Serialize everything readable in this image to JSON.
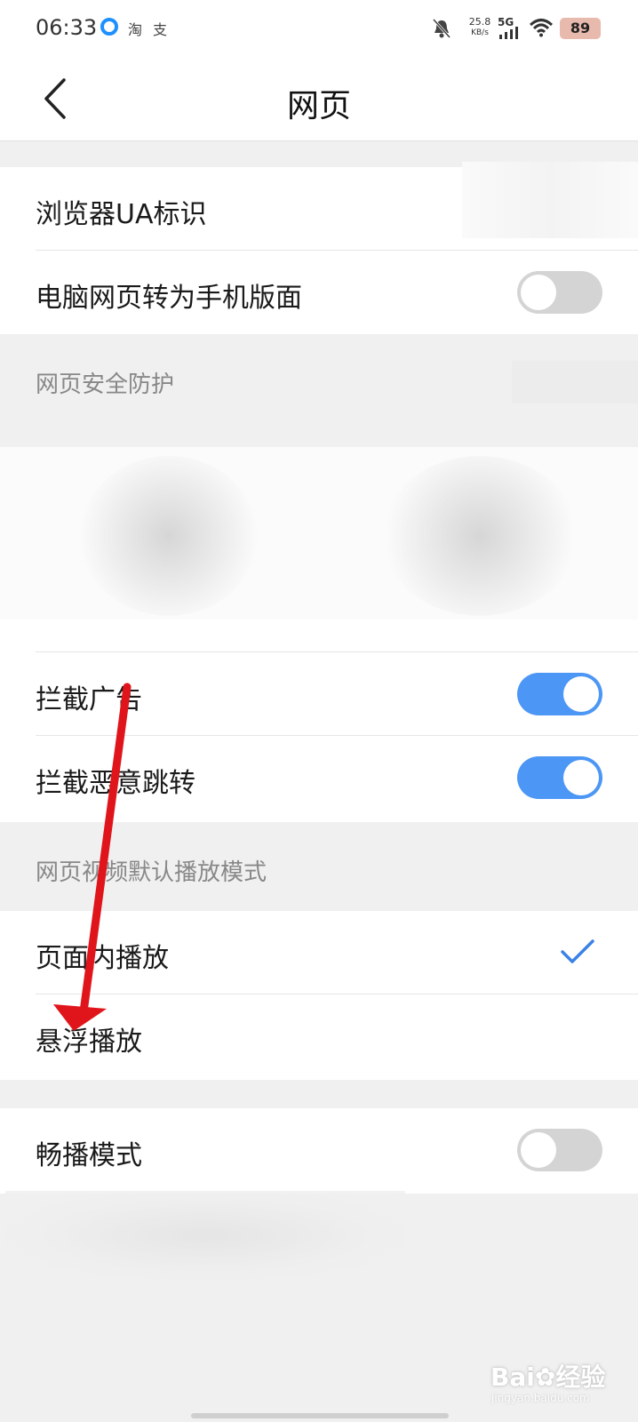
{
  "status_bar": {
    "time": "06:33",
    "app_glyph_1": "淘",
    "app_glyph_2": "支",
    "net_speed_value": "25.8",
    "net_speed_unit": "KB/s",
    "network": "5G",
    "battery": "89"
  },
  "header": {
    "title": "网页"
  },
  "settings": {
    "browser_ua": "浏览器UA标识",
    "desktop_to_mobile": {
      "label": "电脑网页转为手机版面",
      "enabled": false
    },
    "security_section": "网页安全防护",
    "block_ads": {
      "label": "拦截广告",
      "enabled": true
    },
    "block_redirect": {
      "label": "拦截恶意跳转",
      "enabled": true
    },
    "video_section": "网页视频默认播放模式",
    "inline_play": {
      "label": "页面内播放",
      "selected": true
    },
    "floating_play": {
      "label": "悬浮播放",
      "selected": false
    },
    "smooth_mode": {
      "label": "畅播模式",
      "enabled": false
    }
  },
  "watermark": {
    "brand": "Bai",
    "brand_suffix": "经验",
    "url": "jingyan.baidu.com"
  },
  "colors": {
    "accent": "#4c96f5",
    "annotation_arrow": "#e0151b"
  }
}
